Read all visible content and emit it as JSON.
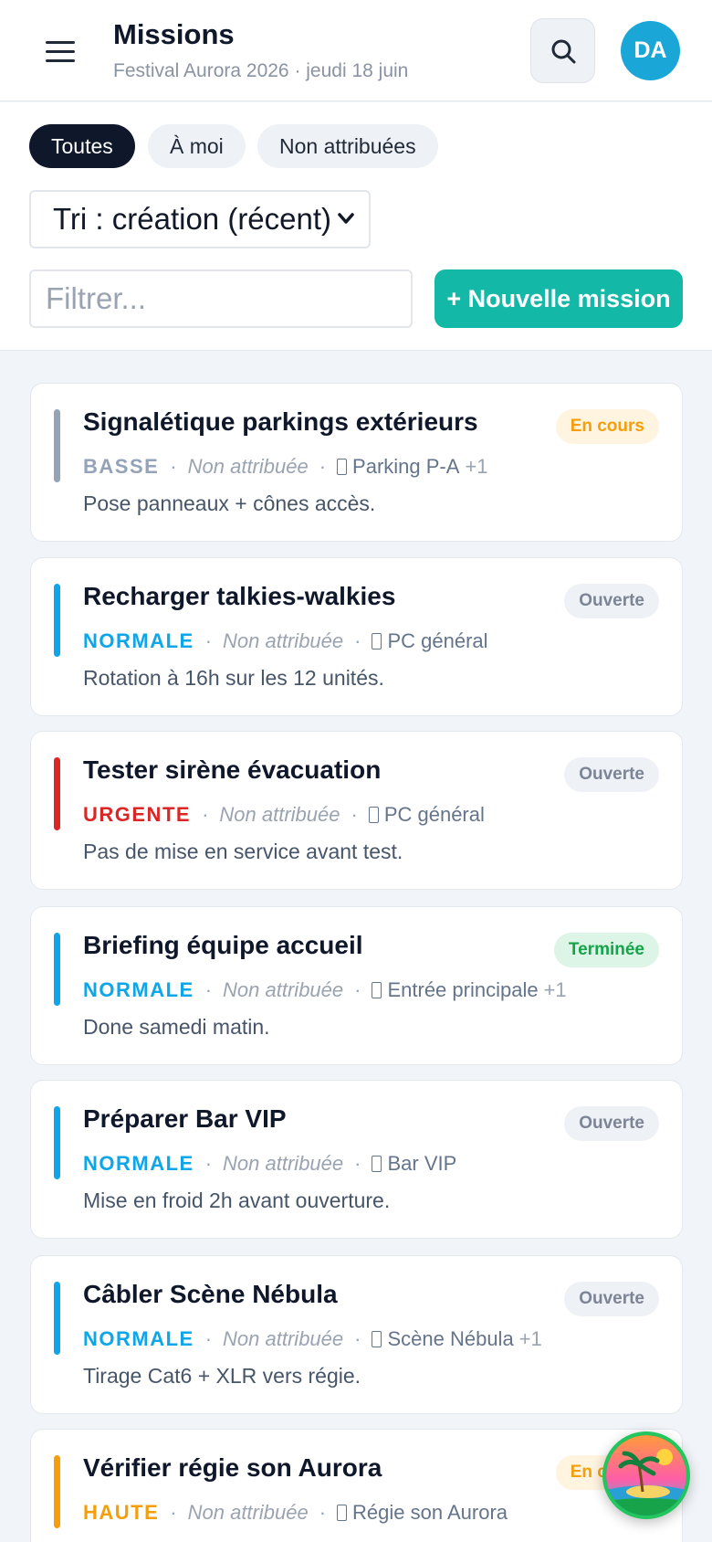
{
  "header": {
    "title": "Missions",
    "subtitle": "Festival Aurora 2026 · jeudi 18 juin",
    "avatar_initials": "DA"
  },
  "filters": {
    "chips": [
      "Toutes",
      "À moi",
      "Non attribuées"
    ],
    "active_chip": "Toutes",
    "sort_label": "Tri : création (récent)",
    "filter_placeholder": "Filtrer...",
    "new_button_label": "+ Nouvelle mission"
  },
  "missions": [
    {
      "title": "Signalétique parkings extérieurs",
      "priority": "BASSE",
      "priority_color": "#94a3b8",
      "assignee": "Non attribuée",
      "location": "Parking P-A",
      "location_extra": "+1",
      "description": "Pose panneaux + cônes accès.",
      "status": "En cours",
      "status_color": "#f59e0b",
      "status_bg": "#fff4e0"
    },
    {
      "title": "Recharger talkies-walkies",
      "priority": "NORMALE",
      "priority_color": "#0ea5e9",
      "assignee": "Non attribuée",
      "location": "PC général",
      "location_extra": "",
      "description": "Rotation à 16h sur les 12 unités.",
      "status": "Ouverte",
      "status_color": "#7c8595",
      "status_bg": "#eef1f5"
    },
    {
      "title": "Tester sirène évacuation",
      "priority": "URGENTE",
      "priority_color": "#dc2626",
      "assignee": "Non attribuée",
      "location": "PC général",
      "location_extra": "",
      "description": "Pas de mise en service avant test.",
      "status": "Ouverte",
      "status_color": "#7c8595",
      "status_bg": "#eef1f5"
    },
    {
      "title": "Briefing équipe accueil",
      "priority": "NORMALE",
      "priority_color": "#0ea5e9",
      "assignee": "Non attribuée",
      "location": "Entrée principale",
      "location_extra": "+1",
      "description": "Done samedi matin.",
      "status": "Terminée",
      "status_color": "#16a34a",
      "status_bg": "#dcf5e7"
    },
    {
      "title": "Préparer Bar VIP",
      "priority": "NORMALE",
      "priority_color": "#0ea5e9",
      "assignee": "Non attribuée",
      "location": "Bar VIP",
      "location_extra": "",
      "description": "Mise en froid 2h avant ouverture.",
      "status": "Ouverte",
      "status_color": "#7c8595",
      "status_bg": "#eef1f5"
    },
    {
      "title": "Câbler Scène Nébula",
      "priority": "NORMALE",
      "priority_color": "#0ea5e9",
      "assignee": "Non attribuée",
      "location": "Scène Nébula",
      "location_extra": "+1",
      "description": "Tirage Cat6 + XLR vers régie.",
      "status": "Ouverte",
      "status_color": "#7c8595",
      "status_bg": "#eef1f5"
    },
    {
      "title": "Vérifier régie son Aurora",
      "priority": "HAUTE",
      "priority_color": "#f59e0b",
      "assignee": "Non attribuée",
      "location": "Régie son Aurora",
      "location_extra": "",
      "description": "",
      "status": "En cours",
      "status_color": "#f59e0b",
      "status_bg": "#fff4e0"
    }
  ],
  "meta_separator": "·",
  "colors": {
    "accent": "#14b8a6",
    "avatar": "#1aa6d6",
    "dark": "#0f172a"
  }
}
